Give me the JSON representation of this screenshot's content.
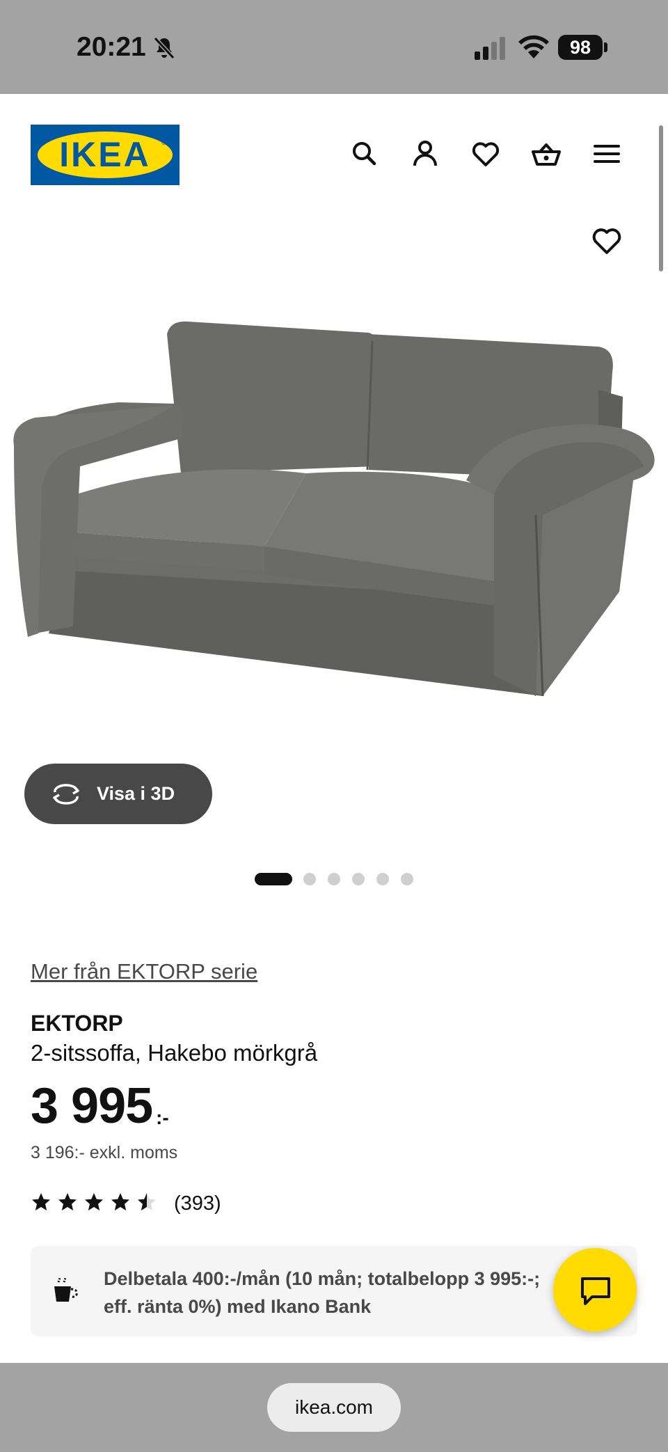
{
  "status_bar": {
    "time": "20:21",
    "battery": "98"
  },
  "header": {
    "logo_text": "IKEA",
    "icons": [
      "search-icon",
      "profile-icon",
      "heart-icon",
      "basket-icon",
      "menu-icon"
    ]
  },
  "gallery": {
    "view_3d_label": "Visa i 3D",
    "dot_count": 6,
    "active_dot": 1
  },
  "product": {
    "series_link": "Mer från EKTORP serie",
    "name": "EKTORP",
    "description": "2-sitssoffa, Hakebo mörkgrå",
    "price": "3 995",
    "price_suffix": ":-",
    "price_ex_vat": "3 196:- exkl. moms",
    "rating": 4.5,
    "review_count": "(393)"
  },
  "installment": {
    "text": "Delbetala 400:-/mån (10 mån; totalbelopp 3 995:-; eff. ränta 0%) med Ikano Bank"
  },
  "browser": {
    "url": "ikea.com"
  },
  "colors": {
    "brand_blue": "#0058a3",
    "brand_yellow": "#ffdb00"
  }
}
